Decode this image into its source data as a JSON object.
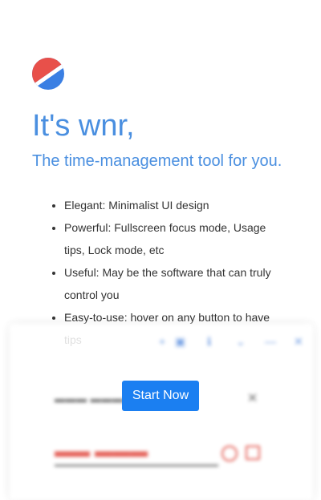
{
  "colors": {
    "accent": "#4a8fe0",
    "button": "#1b7ff1",
    "logo_red": "#e8504a",
    "logo_blue": "#3a7fe3"
  },
  "logo": {
    "icon": "wnr-logo"
  },
  "headline": "It's wnr,",
  "tagline": "The time-management tool for you.",
  "features": [
    "Elegant: Minimalist UI design",
    "Powerful: Fullscreen focus mode, Usage tips, Lock mode, etc",
    "Useful: May be the software that can truly control you",
    "Easy-to-use: hover on any button to have tips"
  ],
  "preview": {
    "toolbar_icons": [
      "plus-icon",
      "calendar-icon",
      "info-icon",
      "chevron-down-icon",
      "minimize-icon",
      "close-icon"
    ],
    "action_icons": [
      "reset-icon",
      "edit-icon"
    ]
  },
  "start_button": "Start Now"
}
